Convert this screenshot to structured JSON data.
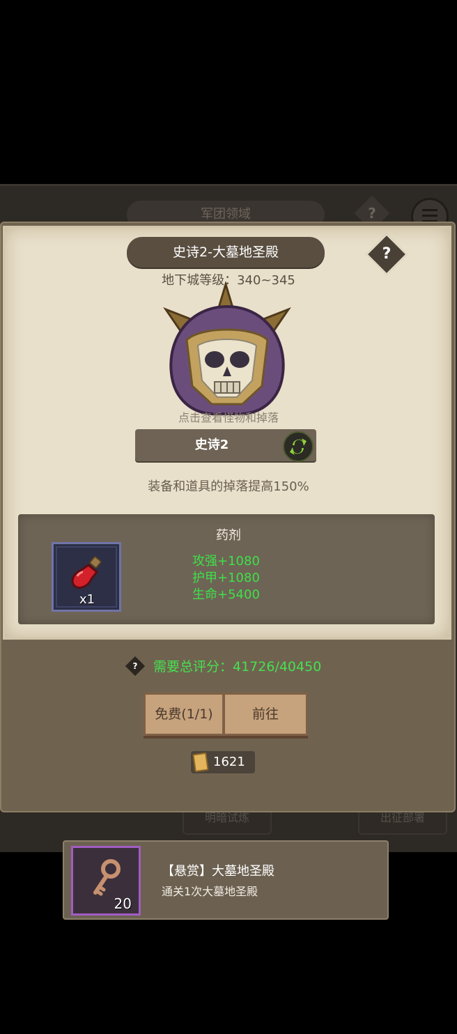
{
  "background": {
    "title": "军团领域",
    "help_symbol": "?",
    "left_button": "明暗试炼",
    "right_button": "出征部署"
  },
  "dialog": {
    "title": "史诗2-大墓地圣殿",
    "help_symbol": "?",
    "dungeon_level": "地下城等级：340~345",
    "hint": "点击查看怪物和掉落",
    "difficulty": "史诗2",
    "drop_bonus": "装备和道具的掉落提高150%",
    "reward": {
      "title": "药剂",
      "item_count": "x1",
      "stats": [
        "攻强+1080",
        "护甲+1080",
        "生命+5400"
      ]
    },
    "score": {
      "help_symbol": "?",
      "text": "需要总评分：41726/40450"
    },
    "buttons": {
      "free": "免费(1/1)",
      "go": "前往"
    },
    "currency": "1621"
  },
  "bounty": {
    "title": "【悬赏】大墓地圣殿",
    "description": "通关1次大墓地圣殿",
    "key_count": "20"
  },
  "colors": {
    "parchment": "#e9e0cb",
    "stat_green": "#3ee04a",
    "button_tan": "#c6a27d",
    "bounty_purple": "#a25cc3"
  },
  "icons": [
    "help-icon",
    "menu-icon",
    "switch-difficulty-icon",
    "potion-icon",
    "scroll-currency-icon",
    "key-icon"
  ]
}
